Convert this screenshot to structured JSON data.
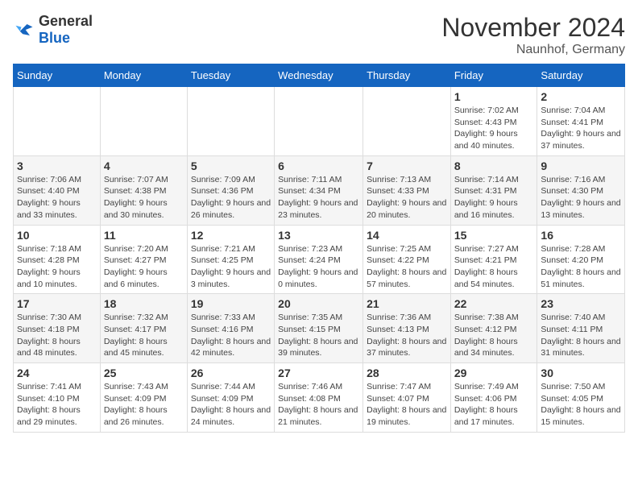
{
  "header": {
    "logo_general": "General",
    "logo_blue": "Blue",
    "month_title": "November 2024",
    "location": "Naunhof, Germany"
  },
  "days_of_week": [
    "Sunday",
    "Monday",
    "Tuesday",
    "Wednesday",
    "Thursday",
    "Friday",
    "Saturday"
  ],
  "weeks": [
    [
      {
        "day": "",
        "info": ""
      },
      {
        "day": "",
        "info": ""
      },
      {
        "day": "",
        "info": ""
      },
      {
        "day": "",
        "info": ""
      },
      {
        "day": "",
        "info": ""
      },
      {
        "day": "1",
        "info": "Sunrise: 7:02 AM\nSunset: 4:43 PM\nDaylight: 9 hours and 40 minutes."
      },
      {
        "day": "2",
        "info": "Sunrise: 7:04 AM\nSunset: 4:41 PM\nDaylight: 9 hours and 37 minutes."
      }
    ],
    [
      {
        "day": "3",
        "info": "Sunrise: 7:06 AM\nSunset: 4:40 PM\nDaylight: 9 hours and 33 minutes."
      },
      {
        "day": "4",
        "info": "Sunrise: 7:07 AM\nSunset: 4:38 PM\nDaylight: 9 hours and 30 minutes."
      },
      {
        "day": "5",
        "info": "Sunrise: 7:09 AM\nSunset: 4:36 PM\nDaylight: 9 hours and 26 minutes."
      },
      {
        "day": "6",
        "info": "Sunrise: 7:11 AM\nSunset: 4:34 PM\nDaylight: 9 hours and 23 minutes."
      },
      {
        "day": "7",
        "info": "Sunrise: 7:13 AM\nSunset: 4:33 PM\nDaylight: 9 hours and 20 minutes."
      },
      {
        "day": "8",
        "info": "Sunrise: 7:14 AM\nSunset: 4:31 PM\nDaylight: 9 hours and 16 minutes."
      },
      {
        "day": "9",
        "info": "Sunrise: 7:16 AM\nSunset: 4:30 PM\nDaylight: 9 hours and 13 minutes."
      }
    ],
    [
      {
        "day": "10",
        "info": "Sunrise: 7:18 AM\nSunset: 4:28 PM\nDaylight: 9 hours and 10 minutes."
      },
      {
        "day": "11",
        "info": "Sunrise: 7:20 AM\nSunset: 4:27 PM\nDaylight: 9 hours and 6 minutes."
      },
      {
        "day": "12",
        "info": "Sunrise: 7:21 AM\nSunset: 4:25 PM\nDaylight: 9 hours and 3 minutes."
      },
      {
        "day": "13",
        "info": "Sunrise: 7:23 AM\nSunset: 4:24 PM\nDaylight: 9 hours and 0 minutes."
      },
      {
        "day": "14",
        "info": "Sunrise: 7:25 AM\nSunset: 4:22 PM\nDaylight: 8 hours and 57 minutes."
      },
      {
        "day": "15",
        "info": "Sunrise: 7:27 AM\nSunset: 4:21 PM\nDaylight: 8 hours and 54 minutes."
      },
      {
        "day": "16",
        "info": "Sunrise: 7:28 AM\nSunset: 4:20 PM\nDaylight: 8 hours and 51 minutes."
      }
    ],
    [
      {
        "day": "17",
        "info": "Sunrise: 7:30 AM\nSunset: 4:18 PM\nDaylight: 8 hours and 48 minutes."
      },
      {
        "day": "18",
        "info": "Sunrise: 7:32 AM\nSunset: 4:17 PM\nDaylight: 8 hours and 45 minutes."
      },
      {
        "day": "19",
        "info": "Sunrise: 7:33 AM\nSunset: 4:16 PM\nDaylight: 8 hours and 42 minutes."
      },
      {
        "day": "20",
        "info": "Sunrise: 7:35 AM\nSunset: 4:15 PM\nDaylight: 8 hours and 39 minutes."
      },
      {
        "day": "21",
        "info": "Sunrise: 7:36 AM\nSunset: 4:13 PM\nDaylight: 8 hours and 37 minutes."
      },
      {
        "day": "22",
        "info": "Sunrise: 7:38 AM\nSunset: 4:12 PM\nDaylight: 8 hours and 34 minutes."
      },
      {
        "day": "23",
        "info": "Sunrise: 7:40 AM\nSunset: 4:11 PM\nDaylight: 8 hours and 31 minutes."
      }
    ],
    [
      {
        "day": "24",
        "info": "Sunrise: 7:41 AM\nSunset: 4:10 PM\nDaylight: 8 hours and 29 minutes."
      },
      {
        "day": "25",
        "info": "Sunrise: 7:43 AM\nSunset: 4:09 PM\nDaylight: 8 hours and 26 minutes."
      },
      {
        "day": "26",
        "info": "Sunrise: 7:44 AM\nSunset: 4:09 PM\nDaylight: 8 hours and 24 minutes."
      },
      {
        "day": "27",
        "info": "Sunrise: 7:46 AM\nSunset: 4:08 PM\nDaylight: 8 hours and 21 minutes."
      },
      {
        "day": "28",
        "info": "Sunrise: 7:47 AM\nSunset: 4:07 PM\nDaylight: 8 hours and 19 minutes."
      },
      {
        "day": "29",
        "info": "Sunrise: 7:49 AM\nSunset: 4:06 PM\nDaylight: 8 hours and 17 minutes."
      },
      {
        "day": "30",
        "info": "Sunrise: 7:50 AM\nSunset: 4:05 PM\nDaylight: 8 hours and 15 minutes."
      }
    ]
  ]
}
